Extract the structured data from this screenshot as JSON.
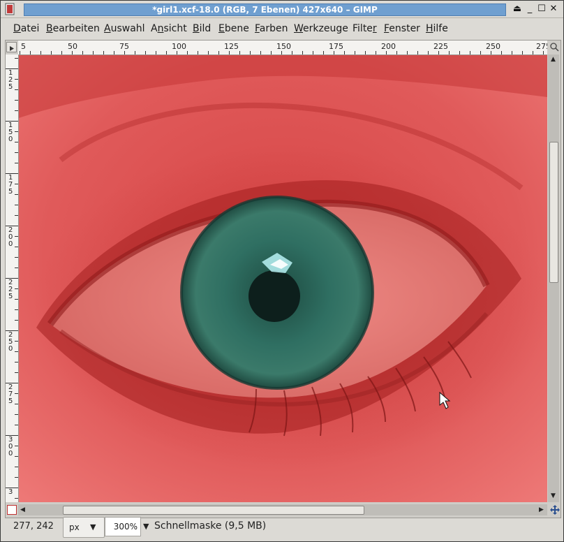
{
  "window": {
    "title": "*girl1.xcf-18.0 (RGB, 7 Ebenen) 427x640 – GIMP",
    "controls": {
      "shade": "⏏",
      "minimize": "_",
      "maximize": "☐",
      "close": "✕"
    }
  },
  "menu": [
    {
      "pre": "",
      "key": "D",
      "post": "atei"
    },
    {
      "pre": "",
      "key": "B",
      "post": "earbeiten"
    },
    {
      "pre": "",
      "key": "A",
      "post": "uswahl"
    },
    {
      "pre": "A",
      "key": "n",
      "post": "sicht"
    },
    {
      "pre": "",
      "key": "B",
      "post": "ild"
    },
    {
      "pre": "",
      "key": "E",
      "post": "bene"
    },
    {
      "pre": "",
      "key": "F",
      "post": "arben"
    },
    {
      "pre": "",
      "key": "W",
      "post": "erkzeuge"
    },
    {
      "pre": "Filte",
      "key": "r",
      "post": ""
    },
    {
      "pre": "",
      "key": "F",
      "post": "enster"
    },
    {
      "pre": "",
      "key": "H",
      "post": "ilfe"
    }
  ],
  "ruler": {
    "horizontal_labels": [
      "5",
      "50",
      "75",
      "100",
      "125",
      "150",
      "175",
      "200",
      "225",
      "250",
      "275"
    ],
    "vertical_labels": [
      "125",
      "150",
      "175",
      "200",
      "225",
      "250",
      "275",
      "300",
      "3"
    ]
  },
  "status": {
    "pointer_coords": "277, 242",
    "unit": "px",
    "zoom": "300",
    "zoom_suffix": "%",
    "message": "Schnellmaske (9,5 MB)"
  },
  "icons": {
    "app": "gimp-document-icon",
    "ruler_menu": "menu-triangle-icon",
    "navigate": "navigate-arrows-icon",
    "quick_mask": "quick-mask-icon",
    "cursor": "pointer-cursor-icon"
  },
  "colors": {
    "title_bar": "#6f9fd0",
    "quick_mask_overlay": "#e05050",
    "iris": "#2f6f62"
  }
}
